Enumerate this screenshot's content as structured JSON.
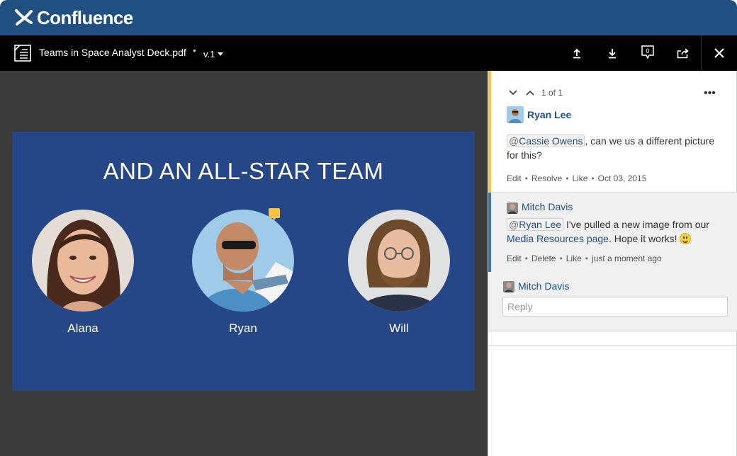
{
  "app": {
    "brand": "Confluence",
    "brand_color": "#205081"
  },
  "viewer": {
    "file_name": "Teams in Space Analyst Deck.pdf",
    "separator": "•",
    "version": "v.1",
    "toolbar_icons": [
      "upload-icon",
      "download-icon",
      "comments-icon",
      "share-icon",
      "close-icon"
    ],
    "comment_count": "0"
  },
  "slide": {
    "title": "AND AN ALL-STAR TEAM",
    "background": "#264787",
    "people": [
      {
        "name": "Alana"
      },
      {
        "name": "Ryan"
      },
      {
        "name": "Will"
      }
    ]
  },
  "comments": {
    "position": "1 of 1",
    "more": "•••",
    "root": {
      "author": "Ryan Lee",
      "mention_at": "@",
      "mention": "Cassie Owens",
      "text": ", can we us a different picture for this?",
      "actions": {
        "edit": "Edit",
        "resolve": "Resolve",
        "like": "Like",
        "date": "Oct 03, 2015"
      }
    },
    "reply": {
      "author": "Mitch Davis",
      "mention_at": "@",
      "mention": "Ryan Lee",
      "text_before_link": " I've pulled a new image from our ",
      "link": "Media Resources page",
      "text_after_link": ". Hope it works! ",
      "actions": {
        "edit": "Edit",
        "delete": "Delete",
        "like": "Like",
        "date": "just a moment ago"
      }
    },
    "composer": {
      "author": "Mitch Davis",
      "placeholder": "Reply"
    },
    "action_separator": "•",
    "highlight_color": "#f6c342",
    "reply_accent_color": "#3b73af"
  }
}
